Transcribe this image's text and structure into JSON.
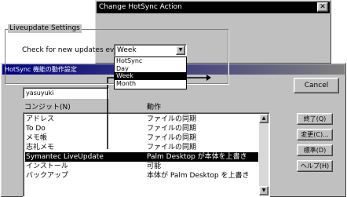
{
  "hotsync_window": {
    "title": "HotSync 機能の動作設定",
    "user_name": "yasuyuki",
    "columns": {
      "conduit": "コンジット(N)",
      "action": "動作"
    },
    "rows": [
      {
        "conduit": "アドレス",
        "action": "ファイルの同期",
        "selected": false
      },
      {
        "conduit": "To Do",
        "action": "ファイルの同期",
        "selected": false
      },
      {
        "conduit": "メモ帳",
        "action": "ファイルの同期",
        "selected": false
      },
      {
        "conduit": "志礼メモ",
        "action": "ファイルの同期",
        "selected": false
      },
      {
        "conduit": "Symantec LiveUpdate",
        "action": "Palm Desktop が本体を上書き",
        "selected": true
      },
      {
        "conduit": "インストール",
        "action": "可能",
        "selected": false
      },
      {
        "conduit": "バックアップ",
        "action": "本体が Palm Desktop を上書き",
        "selected": false
      }
    ],
    "buttons": {
      "cancel": "Cancel",
      "done": "終了(Q)",
      "change": "変更(C)...",
      "default": "標準(D)",
      "help": "ヘルプ(H)"
    }
  },
  "dialog": {
    "title": "Change HotSync Action",
    "close_glyph": "✕",
    "group_label": "Liveupdate Settings",
    "check_label": "Check for new updates every:",
    "selected_value": "Week",
    "options": [
      "HotSync",
      "Day",
      "Week",
      "Month"
    ],
    "highlighted_option": "Week"
  }
}
